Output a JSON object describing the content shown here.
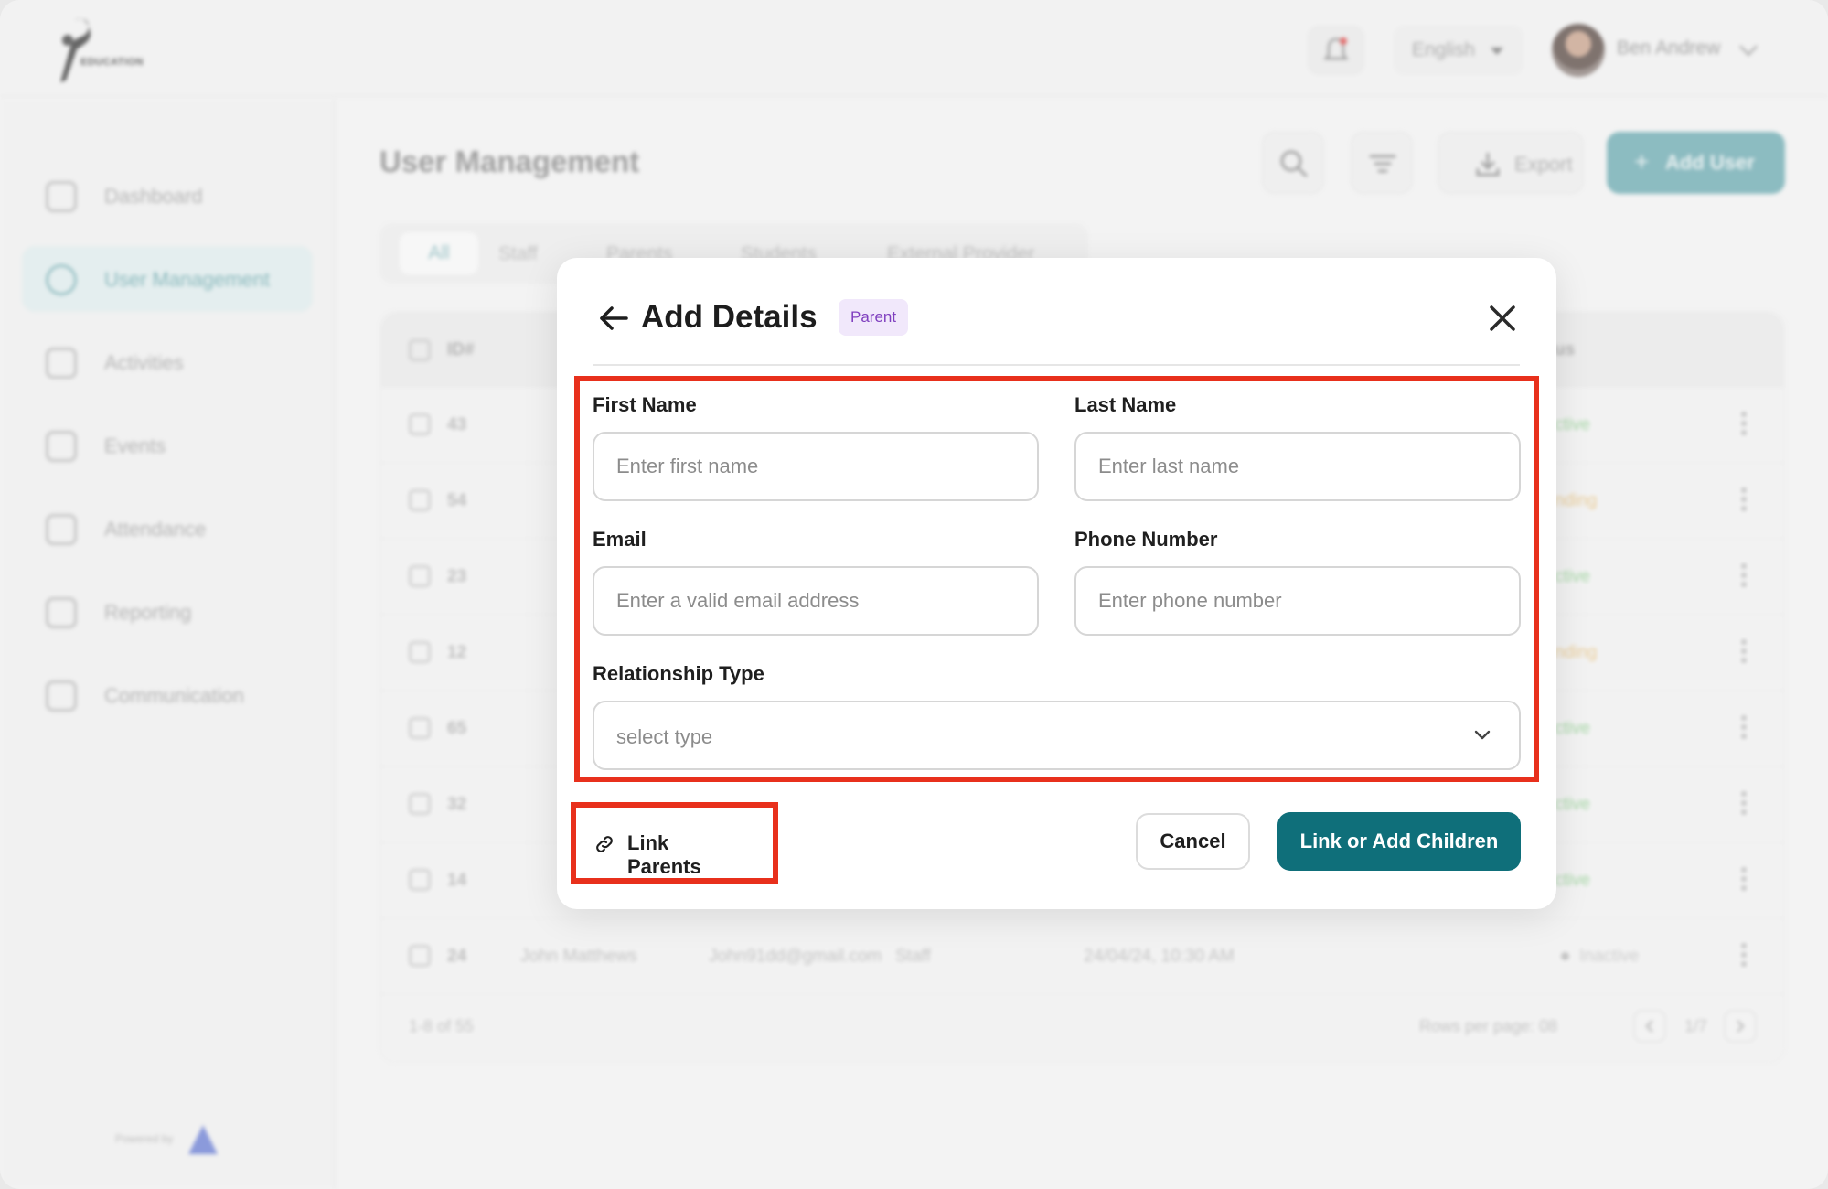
{
  "app": {
    "logo_text": "EDUCATION",
    "language": "English",
    "user_name": "Ben Andrew",
    "powered_by": "Powered by"
  },
  "sidebar": {
    "items": [
      {
        "label": "Dashboard",
        "icon": "grid-icon"
      },
      {
        "label": "User Management",
        "icon": "users-icon",
        "active": true
      },
      {
        "label": "Activities",
        "icon": "activity-icon"
      },
      {
        "label": "Events",
        "icon": "calendar-icon"
      },
      {
        "label": "Attendance",
        "icon": "attendance-icon"
      },
      {
        "label": "Reporting",
        "icon": "bar-chart-icon"
      },
      {
        "label": "Communication",
        "icon": "chat-icon"
      }
    ]
  },
  "main": {
    "title": "User Management",
    "export_label": "Export",
    "add_user_label": "Add User",
    "tabs": [
      "All",
      "Staff",
      "Parents",
      "Students",
      "External Provider"
    ],
    "table": {
      "header_id": "ID#",
      "header_status": "us",
      "rows": [
        {
          "id": "43",
          "status": "ctive",
          "status_color": "#8fd08f"
        },
        {
          "id": "54",
          "status": "nding",
          "status_color": "#e9c27c"
        },
        {
          "id": "23",
          "status": "ctive",
          "status_color": "#8fd08f"
        },
        {
          "id": "12",
          "status": "nding",
          "status_color": "#e9c27c"
        },
        {
          "id": "65",
          "status": "ctive",
          "status_color": "#8fd08f"
        },
        {
          "id": "32",
          "status": "ctive",
          "status_color": "#8fd08f"
        },
        {
          "id": "14",
          "status": "ctive",
          "status_color": "#8fd08f"
        },
        {
          "id": "24",
          "name": "John Matthews",
          "email": "John91dd@gmail.com",
          "role": "Staff",
          "date": "24/04/24, 10:30 AM",
          "status": "Inactive",
          "status_color": "#c4c4c4"
        }
      ],
      "pagination_summary": "1-8 of 55",
      "rows_per_page": "Rows per page: 08",
      "page_indicator": "1/7"
    }
  },
  "modal": {
    "title": "Add Details",
    "badge": "Parent",
    "fields": {
      "first_name": {
        "label": "First Name",
        "placeholder": "Enter first name"
      },
      "last_name": {
        "label": "Last Name",
        "placeholder": "Enter last name"
      },
      "email": {
        "label": "Email",
        "placeholder": "Enter a valid email address"
      },
      "phone": {
        "label": "Phone Number",
        "placeholder": "Enter phone number"
      },
      "relationship": {
        "label": "Relationship Type",
        "placeholder": "select type"
      }
    },
    "link_parents_label": "Link Parents",
    "cancel_label": "Cancel",
    "primary_label": "Link or Add Children"
  },
  "colors": {
    "primary": "#0f6f7a",
    "highlight": "#e8301c",
    "badge_bg": "#f1e8fb",
    "badge_text": "#7f3fbf"
  }
}
